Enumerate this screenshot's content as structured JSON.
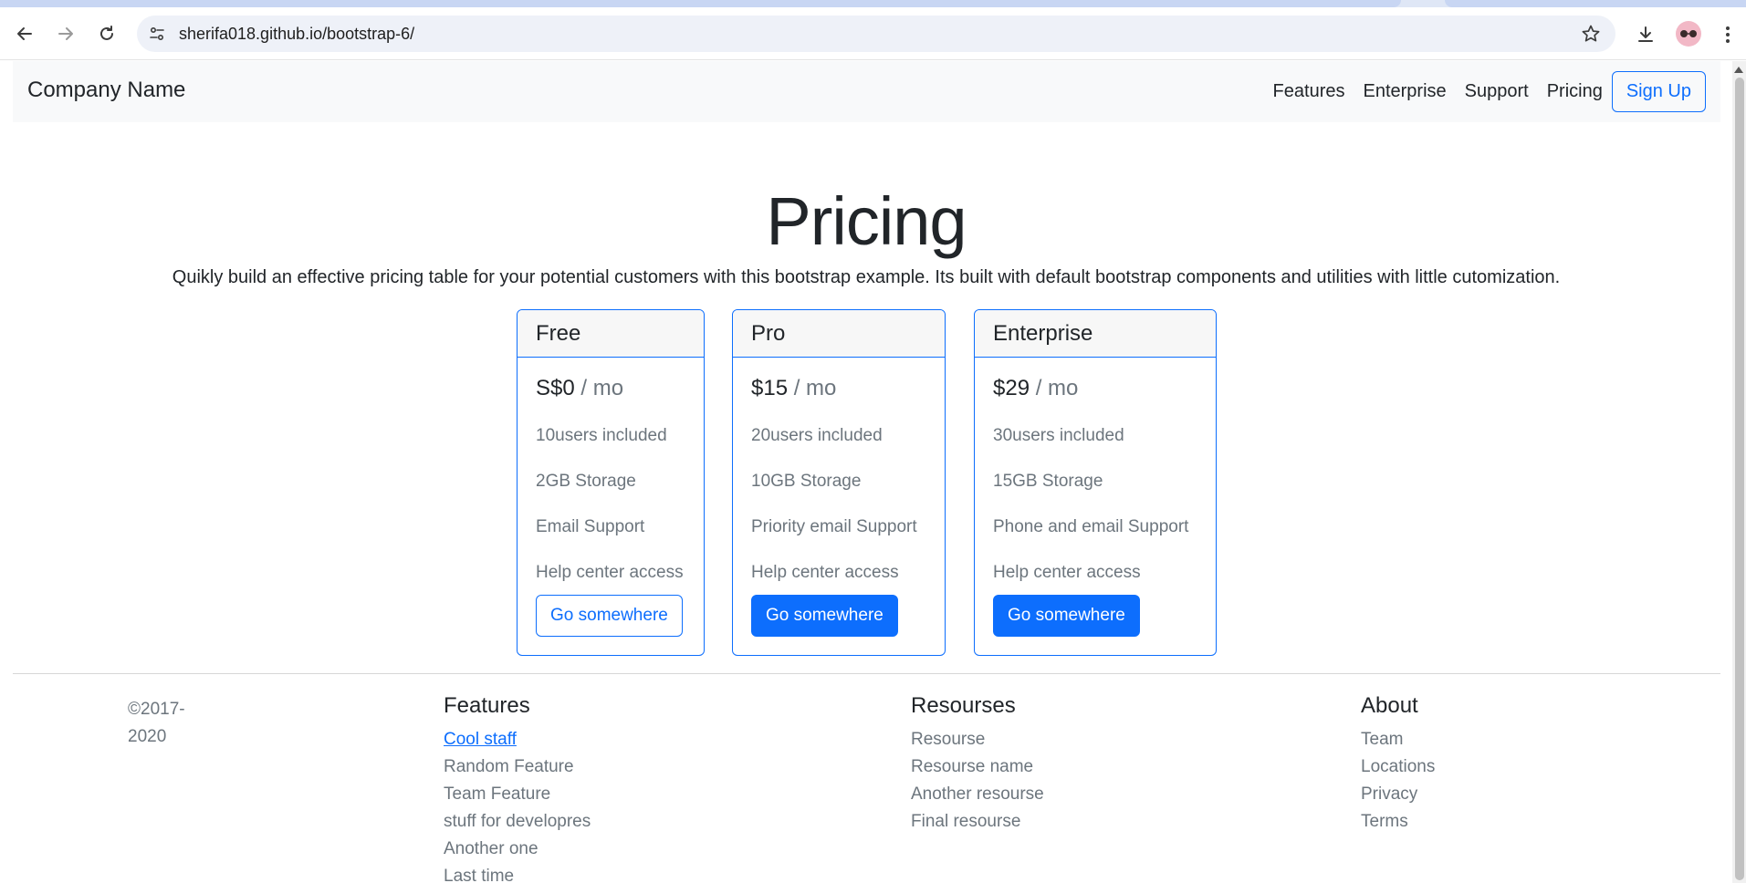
{
  "browser": {
    "url": "sherifa018.github.io/bootstrap-6/"
  },
  "navbar": {
    "brand": "Company Name",
    "links": [
      "Features",
      "Enterprise",
      "Support",
      "Pricing"
    ],
    "signup": "Sign Up"
  },
  "hero": {
    "title": "Pricing",
    "lead": "Quikly build an effective pricing table for your potential customers with this bootstrap example. Its built with default bootstrap components and utilities with little cutomization."
  },
  "plans": [
    {
      "name": "Free",
      "price": "S$0",
      "period": " / mo",
      "features": [
        "10users included",
        "2GB Storage",
        "Email Support",
        "Help center access"
      ],
      "button": "Go somewhere"
    },
    {
      "name": "Pro",
      "price": "$15",
      "period": " / mo",
      "features": [
        "20users included",
        "10GB Storage",
        "Priority email Support",
        "Help center access"
      ],
      "button": "Go somewhere"
    },
    {
      "name": "Enterprise",
      "price": "$29",
      "period": " / mo",
      "features": [
        "30users included",
        "15GB Storage",
        "Phone and email Support",
        "Help center access"
      ],
      "button": "Go somewhere"
    }
  ],
  "footer": {
    "copyright": "©2017-2020",
    "features": {
      "title": "Features",
      "links": [
        "Cool staff",
        "Random Feature",
        "Team Feature",
        "stuff for developres",
        "Another one",
        "Last time"
      ]
    },
    "resources": {
      "title": "Resourses",
      "links": [
        "Resourse",
        "Resourse name",
        "Another resourse",
        "Final resourse"
      ]
    },
    "about": {
      "title": "About",
      "links": [
        "Team",
        "Locations",
        "Privacy",
        "Terms"
      ]
    }
  },
  "colors": {
    "primary": "#0d6efd",
    "muted": "#6c757d",
    "navbar_bg": "#f8f9fa"
  }
}
